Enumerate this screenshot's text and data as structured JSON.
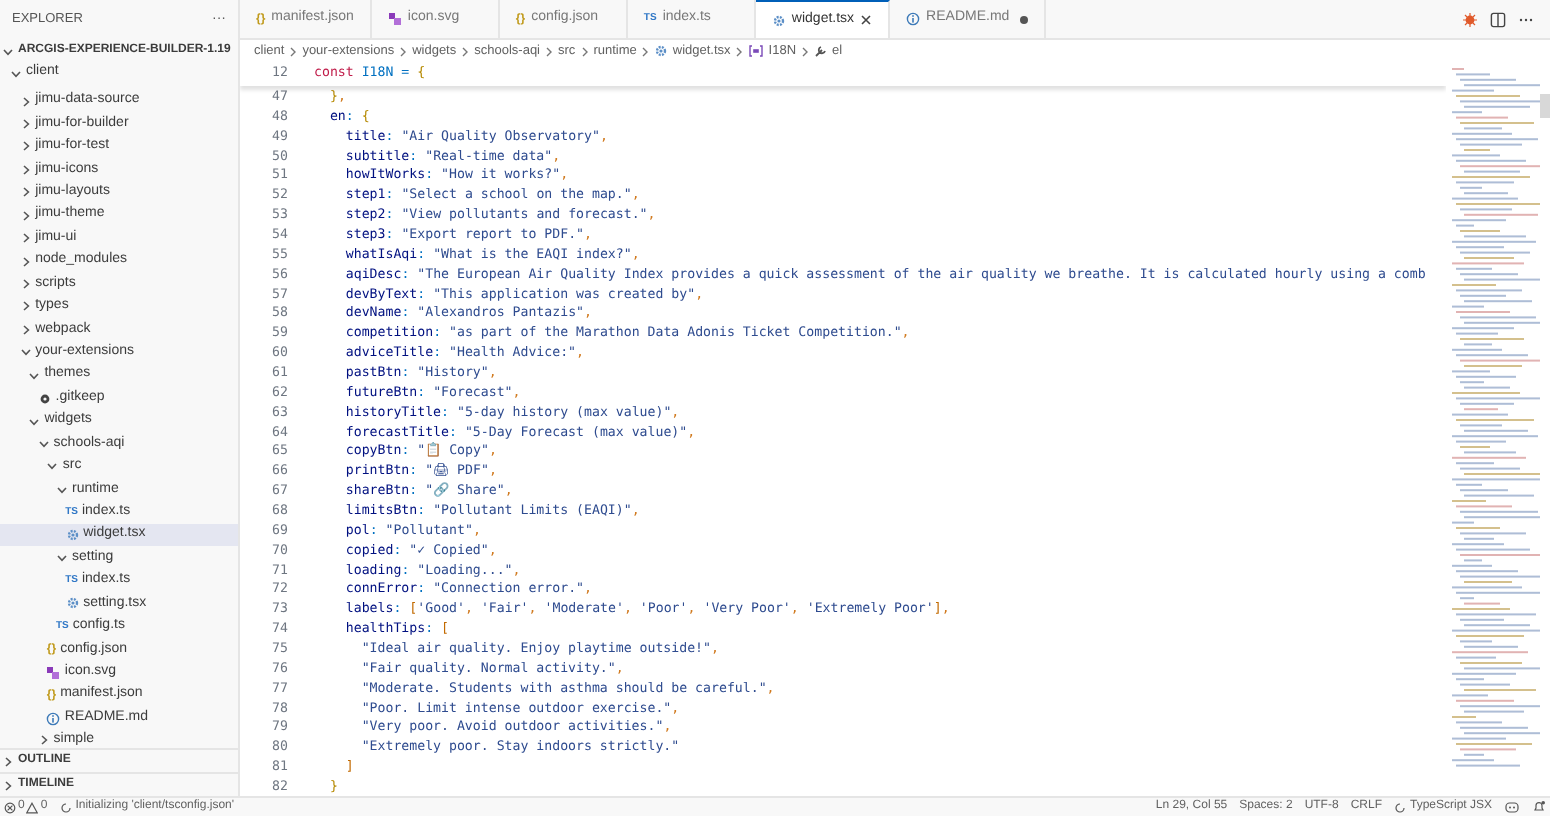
{
  "explorer": {
    "title": "EXPLORER",
    "more": "···",
    "root": "ARCGIS-EXPERIENCE-BUILDER-1.19",
    "tree": [
      {
        "label": "client",
        "kind": "folder",
        "expanded": true,
        "selected": false,
        "children": [
          {
            "label": "jimu-data-source",
            "kind": "folder",
            "expanded": false,
            "selected": false
          },
          {
            "label": "jimu-for-builder",
            "kind": "folder",
            "expanded": false,
            "selected": false
          },
          {
            "label": "jimu-for-test",
            "kind": "folder",
            "expanded": false,
            "selected": false
          },
          {
            "label": "jimu-icons",
            "kind": "folder",
            "expanded": false,
            "selected": false
          },
          {
            "label": "jimu-layouts",
            "kind": "folder",
            "expanded": false,
            "selected": false
          },
          {
            "label": "jimu-theme",
            "kind": "folder",
            "expanded": false,
            "selected": false
          },
          {
            "label": "jimu-ui",
            "kind": "folder",
            "expanded": false,
            "selected": false
          },
          {
            "label": "node_modules",
            "kind": "folder",
            "expanded": false,
            "selected": false
          },
          {
            "label": "scripts",
            "kind": "folder",
            "expanded": false,
            "selected": false
          },
          {
            "label": "types",
            "kind": "folder",
            "expanded": false,
            "selected": false
          },
          {
            "label": "webpack",
            "kind": "folder",
            "expanded": false,
            "selected": false
          },
          {
            "label": "your-extensions",
            "kind": "folder",
            "expanded": true,
            "selected": false,
            "children": [
              {
                "label": "themes",
                "kind": "folder",
                "expanded": true,
                "selected": false,
                "children": [
                  {
                    "label": ".gitkeep",
                    "kind": "git",
                    "selected": false
                  }
                ]
              },
              {
                "label": "widgets",
                "kind": "folder",
                "expanded": true,
                "selected": false,
                "children": [
                  {
                    "label": "schools-aqi",
                    "kind": "folder",
                    "expanded": true,
                    "selected": false,
                    "children": [
                      {
                        "label": "src",
                        "kind": "folder",
                        "expanded": true,
                        "selected": false,
                        "children": [
                          {
                            "label": "runtime",
                            "kind": "folder",
                            "expanded": true,
                            "selected": false,
                            "children": [
                              {
                                "label": "index.ts",
                                "kind": "ts",
                                "badge": "TS",
                                "selected": false
                              },
                              {
                                "label": "widget.tsx",
                                "kind": "tsx",
                                "selected": true
                              }
                            ]
                          },
                          {
                            "label": "setting",
                            "kind": "folder",
                            "expanded": true,
                            "selected": false,
                            "children": [
                              {
                                "label": "index.ts",
                                "kind": "ts",
                                "badge": "TS",
                                "selected": false
                              },
                              {
                                "label": "setting.tsx",
                                "kind": "tsx",
                                "selected": false
                              }
                            ]
                          },
                          {
                            "label": "config.ts",
                            "kind": "ts",
                            "badge": "TS",
                            "selected": false
                          }
                        ]
                      },
                      {
                        "label": "config.json",
                        "kind": "json",
                        "badge": "{}",
                        "selected": false
                      },
                      {
                        "label": "icon.svg",
                        "kind": "svg",
                        "selected": false
                      },
                      {
                        "label": "manifest.json",
                        "kind": "json",
                        "badge": "{}",
                        "selected": false
                      },
                      {
                        "label": "README.md",
                        "kind": "md",
                        "selected": false
                      }
                    ]
                  },
                  {
                    "label": "simple",
                    "kind": "folder",
                    "expanded": false,
                    "selected": false
                  }
                ]
              }
            ]
          }
        ]
      }
    ],
    "sections": [
      {
        "label": "OUTLINE",
        "expanded": false
      },
      {
        "label": "TIMELINE",
        "expanded": false
      }
    ]
  },
  "tabs": [
    {
      "label": "manifest.json",
      "kind": "json",
      "badge": "{}",
      "selected": false,
      "modified": false
    },
    {
      "label": "icon.svg",
      "kind": "svg",
      "selected": false,
      "modified": false
    },
    {
      "label": "config.json",
      "kind": "json",
      "badge": "{}",
      "selected": false,
      "modified": false
    },
    {
      "label": "index.ts",
      "kind": "ts",
      "badge": "TS",
      "selected": false,
      "modified": false
    },
    {
      "label": "widget.tsx",
      "kind": "tsx",
      "selected": true,
      "modified": false
    },
    {
      "label": "README.md",
      "kind": "md",
      "selected": false,
      "modified": true
    }
  ],
  "breadcrumb": [
    {
      "label": "client",
      "kind": "folder"
    },
    {
      "label": "your-extensions",
      "kind": "folder"
    },
    {
      "label": "widgets",
      "kind": "folder"
    },
    {
      "label": "schools-aqi",
      "kind": "folder"
    },
    {
      "label": "src",
      "kind": "folder"
    },
    {
      "label": "runtime",
      "kind": "folder"
    },
    {
      "label": "widget.tsx",
      "kind": "tsx"
    },
    {
      "label": "I18N",
      "kind": "variable"
    },
    {
      "label": "el",
      "kind": "property"
    }
  ],
  "sticky_line": {
    "number": "12",
    "text": "const I18N = {"
  },
  "code_lines": [
    {
      "number": "47",
      "text": "  },"
    },
    {
      "number": "48",
      "text": "  en: {"
    },
    {
      "number": "49",
      "text": "    title: \"Air Quality Observatory\","
    },
    {
      "number": "50",
      "text": "    subtitle: \"Real-time data\","
    },
    {
      "number": "51",
      "text": "    howItWorks: \"How it works?\","
    },
    {
      "number": "52",
      "text": "    step1: \"Select a school on the map.\","
    },
    {
      "number": "53",
      "text": "    step2: \"View pollutants and forecast.\","
    },
    {
      "number": "54",
      "text": "    step3: \"Export report to PDF.\","
    },
    {
      "number": "55",
      "text": "    whatIsAqi: \"What is the EAQI index?\","
    },
    {
      "number": "56",
      "text": "    aqiDesc: \"The European Air Quality Index provides a quick assessment of the air quality we breathe. It is calculated hourly using a comb"
    },
    {
      "number": "57",
      "text": "    devByText: \"This application was created by\","
    },
    {
      "number": "58",
      "text": "    devName: \"Alexandros Pantazis\","
    },
    {
      "number": "59",
      "text": "    competition: \"as part of the Marathon Data Adonis Ticket Competition.\","
    },
    {
      "number": "60",
      "text": "    adviceTitle: \"Health Advice:\","
    },
    {
      "number": "61",
      "text": "    pastBtn: \"History\","
    },
    {
      "number": "62",
      "text": "    futureBtn: \"Forecast\","
    },
    {
      "number": "63",
      "text": "    historyTitle: \"5-day history (max value)\","
    },
    {
      "number": "64",
      "text": "    forecastTitle: \"5-Day Forecast (max value)\","
    },
    {
      "number": "65",
      "text": "    copyBtn: \"📋 Copy\","
    },
    {
      "number": "66",
      "text": "    printBtn: \"🖨 PDF\","
    },
    {
      "number": "67",
      "text": "    shareBtn: \"🔗 Share\","
    },
    {
      "number": "68",
      "text": "    limitsBtn: \"Pollutant Limits (EAQI)\","
    },
    {
      "number": "69",
      "text": "    pol: \"Pollutant\","
    },
    {
      "number": "70",
      "text": "    copied: \"✓ Copied\","
    },
    {
      "number": "71",
      "text": "    loading: \"Loading...\","
    },
    {
      "number": "72",
      "text": "    connError: \"Connection error.\","
    },
    {
      "number": "73",
      "text": "    labels: ['Good', 'Fair', 'Moderate', 'Poor', 'Very Poor', 'Extremely Poor'],"
    },
    {
      "number": "74",
      "text": "    healthTips: ["
    },
    {
      "number": "75",
      "text": "      \"Ideal air quality. Enjoy playtime outside!\","
    },
    {
      "number": "76",
      "text": "      \"Fair quality. Normal activity.\","
    },
    {
      "number": "77",
      "text": "      \"Moderate. Students with asthma should be careful.\","
    },
    {
      "number": "78",
      "text": "      \"Poor. Limit intense outdoor exercise.\","
    },
    {
      "number": "79",
      "text": "      \"Very poor. Avoid outdoor activities.\","
    },
    {
      "number": "80",
      "text": "      \"Extremely poor. Stay indoors strictly.\""
    },
    {
      "number": "81",
      "text": "    ]"
    },
    {
      "number": "82",
      "text": "  }"
    }
  ],
  "status_bar": {
    "errors": "0",
    "warnings": "0",
    "message": "Initializing 'client/tsconfig.json'",
    "position": "Ln 29, Col 55",
    "indent": "Spaces: 2",
    "encoding": "UTF-8",
    "eol": "CRLF",
    "language": "TypeScript JSX"
  }
}
